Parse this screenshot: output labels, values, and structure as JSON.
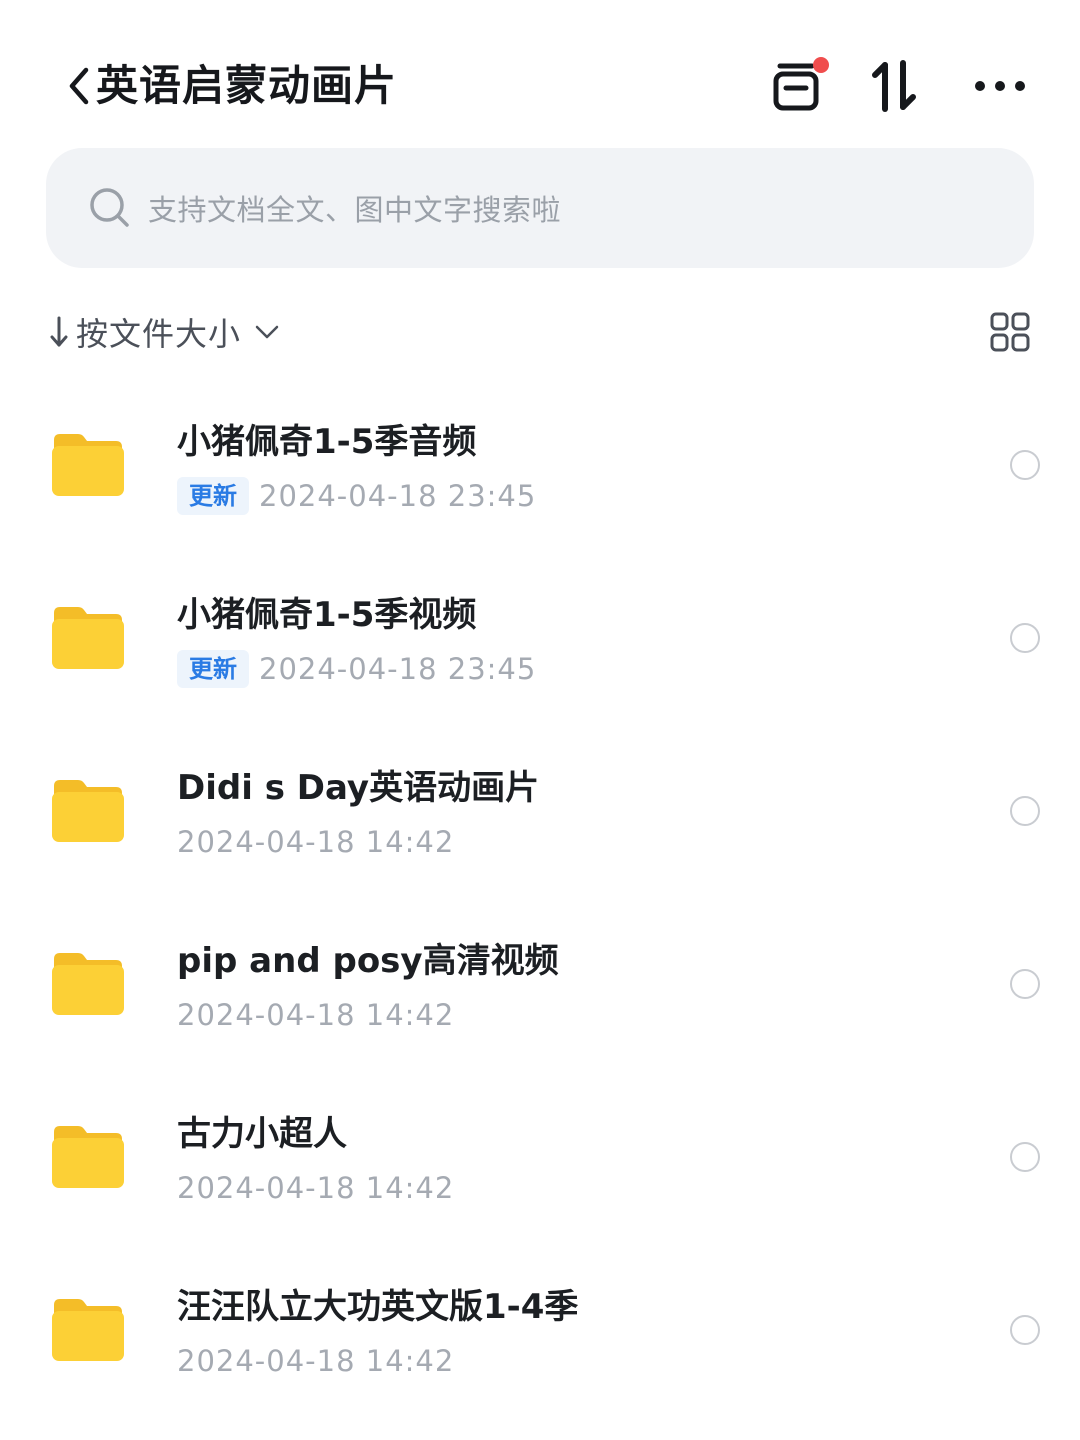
{
  "header": {
    "back_icon": "chevron-left-icon",
    "title": "英语启蒙动画片",
    "cabinet_icon": "cabinet-icon",
    "transfer_icon": "transfer-sort-icon",
    "more_icon": "more-horizontal-icon",
    "notification_dot_color": "#f04d4d"
  },
  "search": {
    "placeholder": "支持文档全文、图中文字搜索啦",
    "icon": "search-icon"
  },
  "sort": {
    "direction_icon": "arrow-down-icon",
    "label": "按文件大小",
    "dropdown_icon": "chevron-down-icon",
    "view_toggle_icon": "grid-view-icon"
  },
  "colors": {
    "folder": "#fcd036",
    "accent_blue": "#2a7be4",
    "badge_bg": "#edf4fc"
  },
  "files": [
    {
      "name": "小猪佩奇1-5季音频",
      "badge": "更新",
      "date": "2024-04-18 23:45"
    },
    {
      "name": "小猪佩奇1-5季视频",
      "badge": "更新",
      "date": "2024-04-18 23:45"
    },
    {
      "name": "Didi s Day英语动画片",
      "badge": "",
      "date": "2024-04-18 14:42"
    },
    {
      "name": "pip and posy高清视频",
      "badge": "",
      "date": "2024-04-18 14:42"
    },
    {
      "name": "古力小超人",
      "badge": "",
      "date": "2024-04-18 14:42"
    },
    {
      "name": "汪汪队立大功英文版1-4季",
      "badge": "",
      "date": "2024-04-18 14:42"
    }
  ]
}
